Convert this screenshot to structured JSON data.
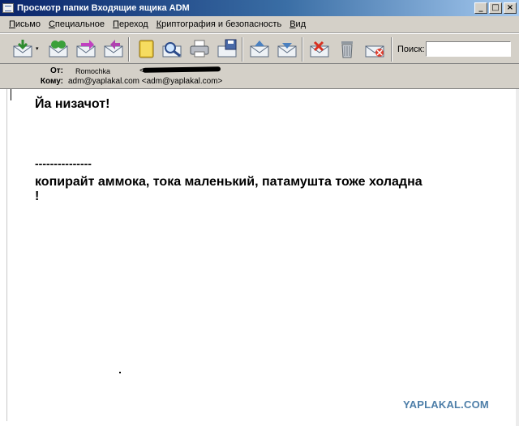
{
  "window": {
    "title": "Просмотр папки Входящие ящика ADM",
    "minimize": "_",
    "maximize": "□",
    "close": "×"
  },
  "menu": [
    {
      "accel": "П",
      "rest": "исьмо"
    },
    {
      "accel": "С",
      "rest": "пециальное"
    },
    {
      "accel": "П",
      "rest": "ереход"
    },
    {
      "accel": "К",
      "rest": "риптография и безопасность"
    },
    {
      "accel": "В",
      "rest": "ид"
    }
  ],
  "toolbar": {
    "dropdown_arrow": "▾",
    "search_label": "Поиск:",
    "search_value": ""
  },
  "header": {
    "from_label": "От:",
    "from_name": "Romochka",
    "from_addr_open": "<",
    "to_label": "Кому:",
    "to_value": "adm@yaplakal.com <adm@yaplakal.com>"
  },
  "message": {
    "line1": "Йа низачот!",
    "separator": "---------------",
    "line2": "копирайт аммока, тока маленький, патамушта тоже холадна",
    "line3": "!"
  },
  "watermark": "YAPLAKAL.COM"
}
